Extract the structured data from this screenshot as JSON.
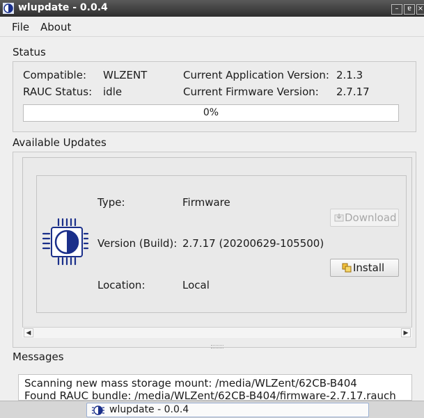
{
  "window": {
    "title": "wlupdate - 0.0.4",
    "minimize_glyph": "–",
    "restore_glyph": "ɐ",
    "close_glyph": "×"
  },
  "menu": {
    "items": [
      "File",
      "About"
    ]
  },
  "status": {
    "heading": "Status",
    "compatible_label": "Compatible:",
    "compatible_value": "WLZENT",
    "rauc_label": "RAUC Status:",
    "rauc_value": "idle",
    "app_version_label": "Current Application Version:",
    "app_version_value": "2.1.3",
    "fw_version_label": "Current Firmware Version:",
    "fw_version_value": "2.7.17",
    "progress_text": "0%",
    "progress_fraction": 0
  },
  "updates": {
    "heading": "Available Updates",
    "item": {
      "icon": "firmware-chip-icon",
      "type_label": "Type:",
      "type_value": "Firmware",
      "version_label": "Version (Build):",
      "version_value": "2.7.17 (20200629-105500)",
      "location_label": "Location:",
      "location_value": "Local",
      "download_label": "Download",
      "install_label": "Install"
    },
    "scroll_left": "◀",
    "scroll_right": "▶"
  },
  "messages": {
    "heading": "Messages",
    "lines": [
      "Scanning new mass storage mount: /media/WLZent/62CB-B404",
      "Found RAUC bundle: /media/WLZent/62CB-B404/firmware-2.7.17.rauch"
    ]
  },
  "taskbar": {
    "item_label": "wlupdate - 0.0.4"
  },
  "colors": {
    "accent": "#3d7cc9",
    "titlebar": "#3a3a3a",
    "icon_blue": "#1a2f8a"
  }
}
